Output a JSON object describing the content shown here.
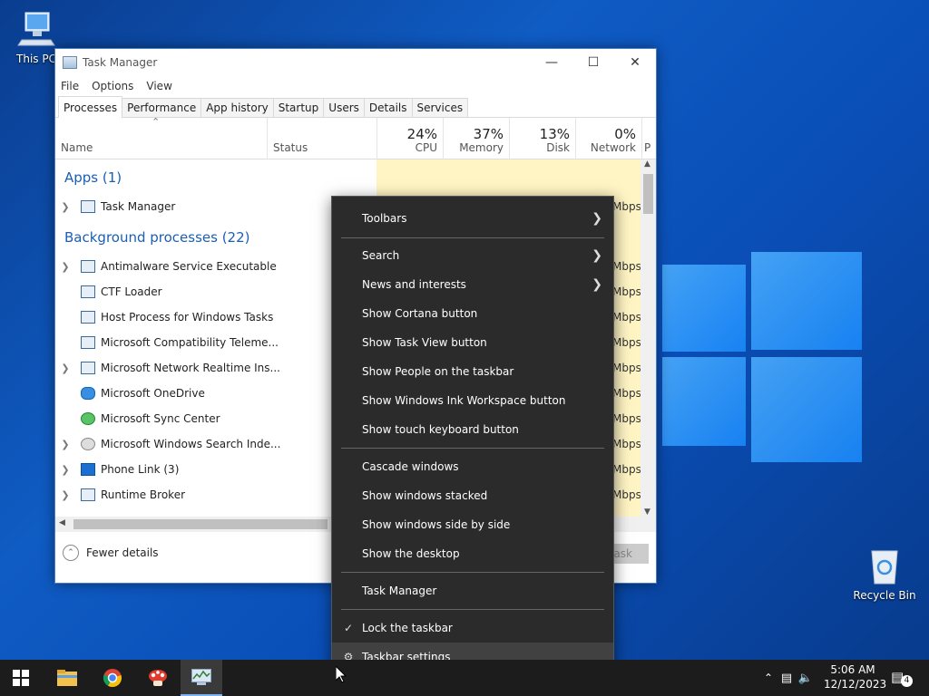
{
  "desktop": {
    "this_pc_label": "This PC",
    "recycle_bin_label": "Recycle Bin"
  },
  "task_manager": {
    "title": "Task Manager",
    "menu": [
      "File",
      "Options",
      "View"
    ],
    "tabs": [
      "Processes",
      "Performance",
      "App history",
      "Startup",
      "Users",
      "Details",
      "Services"
    ],
    "active_tab": "Processes",
    "columns": {
      "name": "Name",
      "status": "Status",
      "cpu": {
        "percent": "24%",
        "label": "CPU"
      },
      "memory": {
        "percent": "37%",
        "label": "Memory"
      },
      "disk": {
        "percent": "13%",
        "label": "Disk"
      },
      "network": {
        "percent": "0%",
        "label": "Network"
      },
      "power_cut": "P"
    },
    "apps_group": "Apps (1)",
    "background_group": "Background processes (22)",
    "apps": [
      {
        "name": "Task Manager",
        "expandable": true,
        "network_cut": "Mbps"
      }
    ],
    "background": [
      {
        "name": "Antimalware Service Executable",
        "expandable": true,
        "network_cut": "Mbps"
      },
      {
        "name": "CTF Loader",
        "expandable": false,
        "network_cut": "Mbps"
      },
      {
        "name": "Host Process for Windows Tasks",
        "expandable": false,
        "network_cut": "Mbps"
      },
      {
        "name": "Microsoft Compatibility Teleme...",
        "expandable": false,
        "network_cut": "Mbps"
      },
      {
        "name": "Microsoft Network Realtime Ins...",
        "expandable": true,
        "network_cut": "Mbps"
      },
      {
        "name": "Microsoft OneDrive",
        "expandable": false,
        "network_cut": "Mbps"
      },
      {
        "name": "Microsoft Sync Center",
        "expandable": false,
        "network_cut": "Mbps"
      },
      {
        "name": "Microsoft Windows Search Inde...",
        "expandable": true,
        "network_cut": "Mbps"
      },
      {
        "name": "Phone Link (3)",
        "expandable": true,
        "network_cut": "Mbps"
      },
      {
        "name": "Runtime Broker",
        "expandable": true,
        "network_cut": "Mbps"
      }
    ],
    "fewer_details": "Fewer details",
    "end_task_cut": "ask"
  },
  "context_menu": {
    "items": [
      {
        "label": "Toolbars",
        "submenu": true
      },
      {
        "label": "Search",
        "submenu": true
      },
      {
        "label": "News and interests",
        "submenu": true
      },
      {
        "label": "Show Cortana button"
      },
      {
        "label": "Show Task View button"
      },
      {
        "label": "Show People on the taskbar"
      },
      {
        "label": "Show Windows Ink Workspace button"
      },
      {
        "label": "Show touch keyboard button"
      },
      {
        "label": "Cascade windows"
      },
      {
        "label": "Show windows stacked"
      },
      {
        "label": "Show windows side by side"
      },
      {
        "label": "Show the desktop"
      },
      {
        "label": "Task Manager"
      },
      {
        "label": "Lock the taskbar",
        "checked": true
      },
      {
        "label": "Taskbar settings",
        "icon": "gear-icon",
        "hovered": true
      }
    ]
  },
  "taskbar": {
    "time": "5:06 AM",
    "date": "12/12/2023",
    "notification_count": "4",
    "pinned": [
      "start-icon",
      "file-explorer-icon",
      "chrome-icon",
      "app-icon",
      "task-manager-icon"
    ]
  },
  "colors": {
    "menu_bg": "#2b2b2b",
    "menu_hover": "#414141",
    "taskbar_bg": "#1c1c1c",
    "group_text": "#1a5fb4",
    "usage_highlight": "#fff4c4"
  }
}
